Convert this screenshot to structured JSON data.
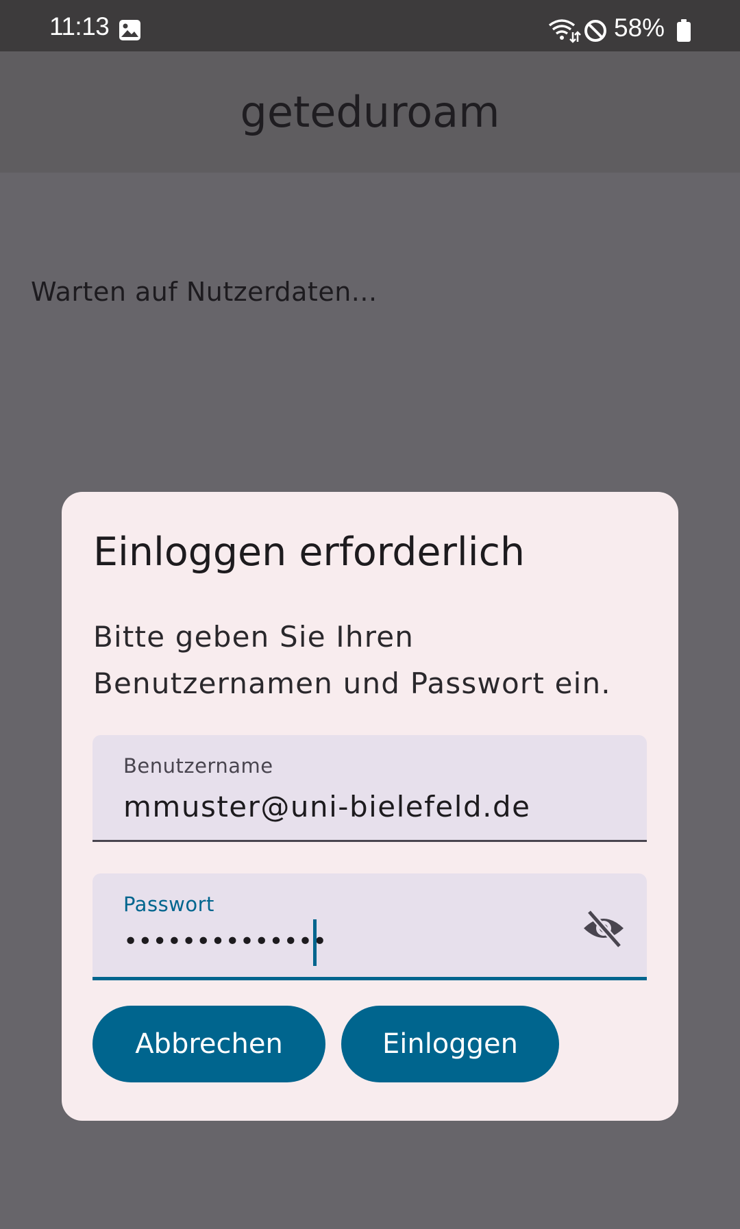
{
  "status_bar": {
    "time": "11:13",
    "battery_text": "58%",
    "icons": [
      "photo-icon",
      "wifi-icon",
      "do-not-disturb-icon",
      "battery-icon"
    ]
  },
  "app": {
    "title": "geteduroam",
    "status_text": "Warten auf Nutzerdaten..."
  },
  "dialog": {
    "title": "Einloggen erforderlich",
    "message": "Bitte geben Sie Ihren Benutzernamen und Passwort ein.",
    "username": {
      "label": "Benutzername",
      "value": "mmuster@uni-bielefeld.de"
    },
    "password": {
      "label": "Passwort",
      "masked_value": "••••••••••••••",
      "visibility_icon": "eye-off-icon"
    },
    "buttons": {
      "cancel": "Abbrechen",
      "login": "Einloggen"
    }
  },
  "colors": {
    "accent": "#00658e",
    "scrim_background": "#67656a",
    "dialog_background": "#f8ecee",
    "field_background": "#e7e0ec"
  }
}
